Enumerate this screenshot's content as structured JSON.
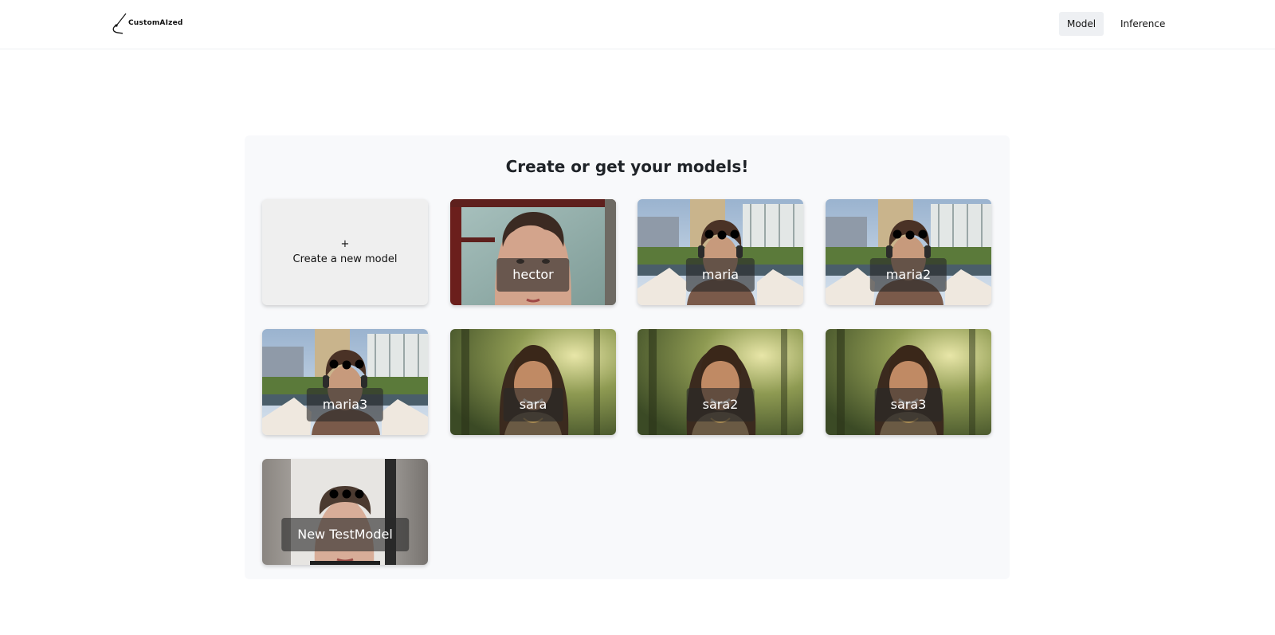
{
  "app": {
    "logo_text": "CustomAIzed"
  },
  "nav": {
    "items": [
      {
        "label": "Model",
        "active": true
      },
      {
        "label": "Inference",
        "active": false
      }
    ],
    "active_bg": "#eef0f3"
  },
  "panel": {
    "title": "Create or get your models!"
  },
  "create_card": {
    "plus": "+",
    "label": "Create a new model"
  },
  "models": [
    {
      "name": "hector",
      "photo": "man-window"
    },
    {
      "name": "maria",
      "photo": "woman-city-headphones"
    },
    {
      "name": "maria2",
      "photo": "woman-city-headphones"
    },
    {
      "name": "maria3",
      "photo": "woman-city-headphones"
    },
    {
      "name": "sara",
      "photo": "girl-forest-sunlight"
    },
    {
      "name": "sara2",
      "photo": "girl-forest-sunlight"
    },
    {
      "name": "sara3",
      "photo": "girl-forest-sunlight"
    },
    {
      "name": "New TestModel",
      "photo": "man-doorway"
    }
  ]
}
